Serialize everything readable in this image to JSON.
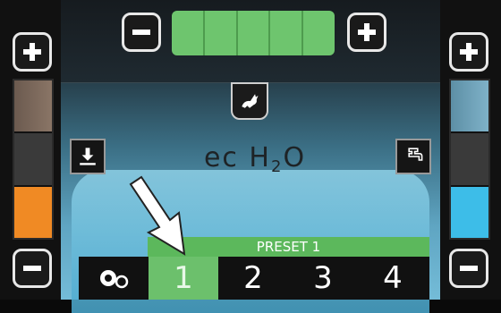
{
  "colors": {
    "speed_on": "#6ec56e",
    "left_level_active": "#f08a24",
    "right_level_active": "#3dbde8",
    "preset_active": "#6cc06c"
  },
  "speed": {
    "level_segments_on": 5,
    "segments_total": 5
  },
  "left_level": {
    "segments_total": 3,
    "active_segments": 1,
    "icon": "download-icon"
  },
  "right_level": {
    "segments_total": 3,
    "active_segments": 1,
    "icon": "water-tap-icon"
  },
  "logo": {
    "prefix": "ec H",
    "subscript": "2",
    "suffix": "O"
  },
  "preset": {
    "label": "PRESET 1",
    "options": [
      "1",
      "2",
      "3",
      "4"
    ],
    "selected_index": 0
  }
}
